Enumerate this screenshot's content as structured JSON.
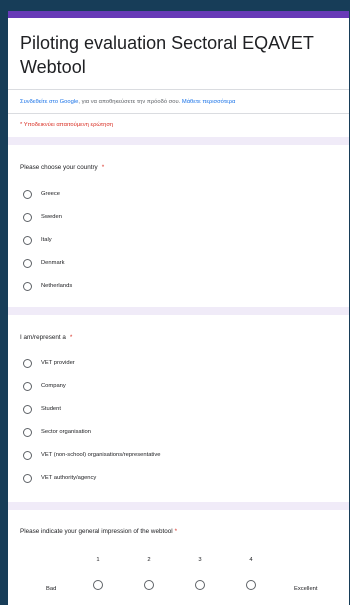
{
  "form": {
    "title": "Piloting evaluation Sectoral EQAVET Webtool",
    "signin_link_text": "Συνδεθείτε στο Google",
    "signin_text": ", για να αποθηκεύσετε την πρόοδό σου.",
    "learn_more": "Μάθετε περισσότερα",
    "required_note": "* Υποδεικνύει απαιτούμενη ερώτηση"
  },
  "q1": {
    "title": "Please choose your country",
    "required_mark": "*",
    "options": [
      "Greece",
      "Sweden",
      "Italy",
      "Denmark",
      "Netherlands"
    ]
  },
  "q2": {
    "title": "I am/represent a",
    "required_mark": "*",
    "options": [
      "VET provider",
      "Company",
      "Student",
      "Sector organisation",
      "VET (non-school) organisations/representative",
      "VET authority/agency"
    ]
  },
  "q3": {
    "title": "Please indicate your general impression of the webtool",
    "required_mark": "*",
    "scale": [
      "1",
      "2",
      "3",
      "4"
    ],
    "low_label": "Bad",
    "high_label": "Excellent"
  },
  "colors": {
    "background": "#173d58",
    "accent": "#673ab7",
    "required": "#d93025",
    "link": "#1a73e8"
  }
}
